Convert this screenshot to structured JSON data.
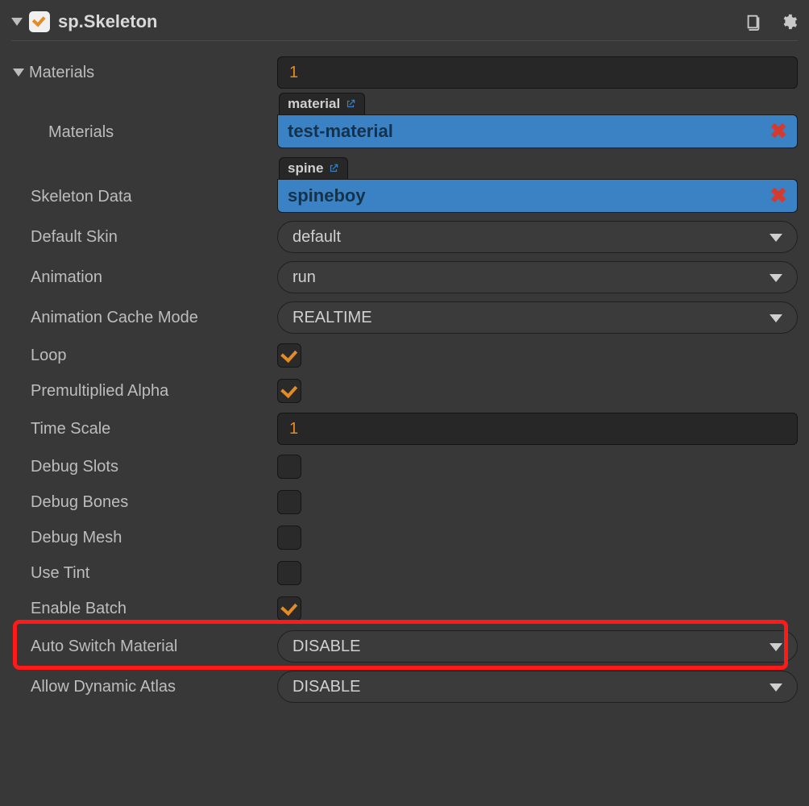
{
  "header": {
    "title": "sp.Skeleton",
    "enabled": true
  },
  "materials": {
    "label": "Materials",
    "count": "1",
    "item_label": "Materials",
    "asset_type": "material",
    "asset_name": "test-material"
  },
  "skeleton_data": {
    "label": "Skeleton Data",
    "asset_type": "spine",
    "asset_name": "spineboy"
  },
  "fields": {
    "default_skin": {
      "label": "Default Skin",
      "value": "default"
    },
    "animation": {
      "label": "Animation",
      "value": "run"
    },
    "cache_mode": {
      "label": "Animation Cache Mode",
      "value": "REALTIME"
    },
    "loop": {
      "label": "Loop",
      "checked": true
    },
    "premul_alpha": {
      "label": "Premultiplied Alpha",
      "checked": true
    },
    "time_scale": {
      "label": "Time Scale",
      "value": "1"
    },
    "debug_slots": {
      "label": "Debug Slots",
      "checked": false
    },
    "debug_bones": {
      "label": "Debug Bones",
      "checked": false
    },
    "debug_mesh": {
      "label": "Debug Mesh",
      "checked": false
    },
    "use_tint": {
      "label": "Use Tint",
      "checked": false
    },
    "enable_batch": {
      "label": "Enable Batch",
      "checked": true
    },
    "auto_switch": {
      "label": "Auto Switch Material",
      "value": "DISABLE"
    },
    "allow_dyn_atlas": {
      "label": "Allow Dynamic Atlas",
      "value": "DISABLE"
    }
  }
}
